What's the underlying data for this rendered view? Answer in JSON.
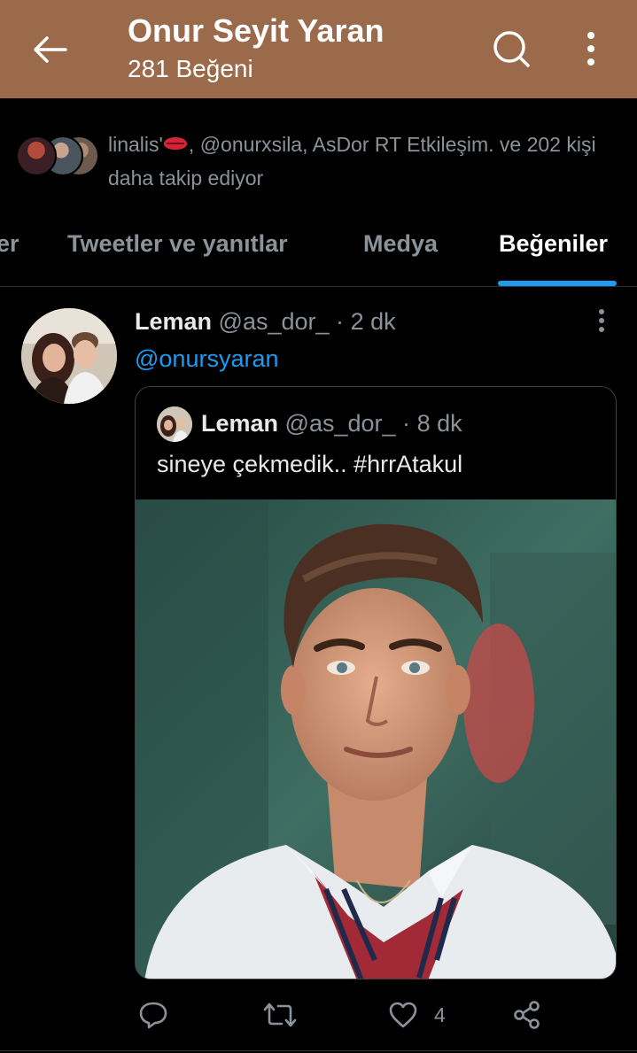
{
  "header": {
    "title": "Onur Seyit Yaran",
    "subtitle": "281 Beğeni",
    "background": "#9a6a4b"
  },
  "followers": {
    "text_before": "linalis'",
    "text_after": ", @onurxsila, AsDor RT Etkileşim. ve 202 kişi daha takip ediyor"
  },
  "tabs": {
    "partial": "er",
    "tweets_replies": "Tweetler ve yanıtlar",
    "media": "Medya",
    "likes": "Beğeniler",
    "active_color": "#1d9bf0"
  },
  "tweet": {
    "name": "Leman",
    "handle": "@as_dor_",
    "sep": "·",
    "time": "2 dk",
    "mention": "@onursyaran",
    "quote": {
      "name": "Leman",
      "handle": "@as_dor_",
      "sep": "·",
      "time": "8 dk",
      "text": "sineye çekmedik.. #hrrAtakul"
    },
    "actions": {
      "like_count": "4"
    }
  },
  "icons": [
    "arrow-left-icon",
    "search-icon",
    "more-vertical-icon",
    "reply-icon",
    "retweet-icon",
    "heart-icon",
    "share-icon"
  ]
}
